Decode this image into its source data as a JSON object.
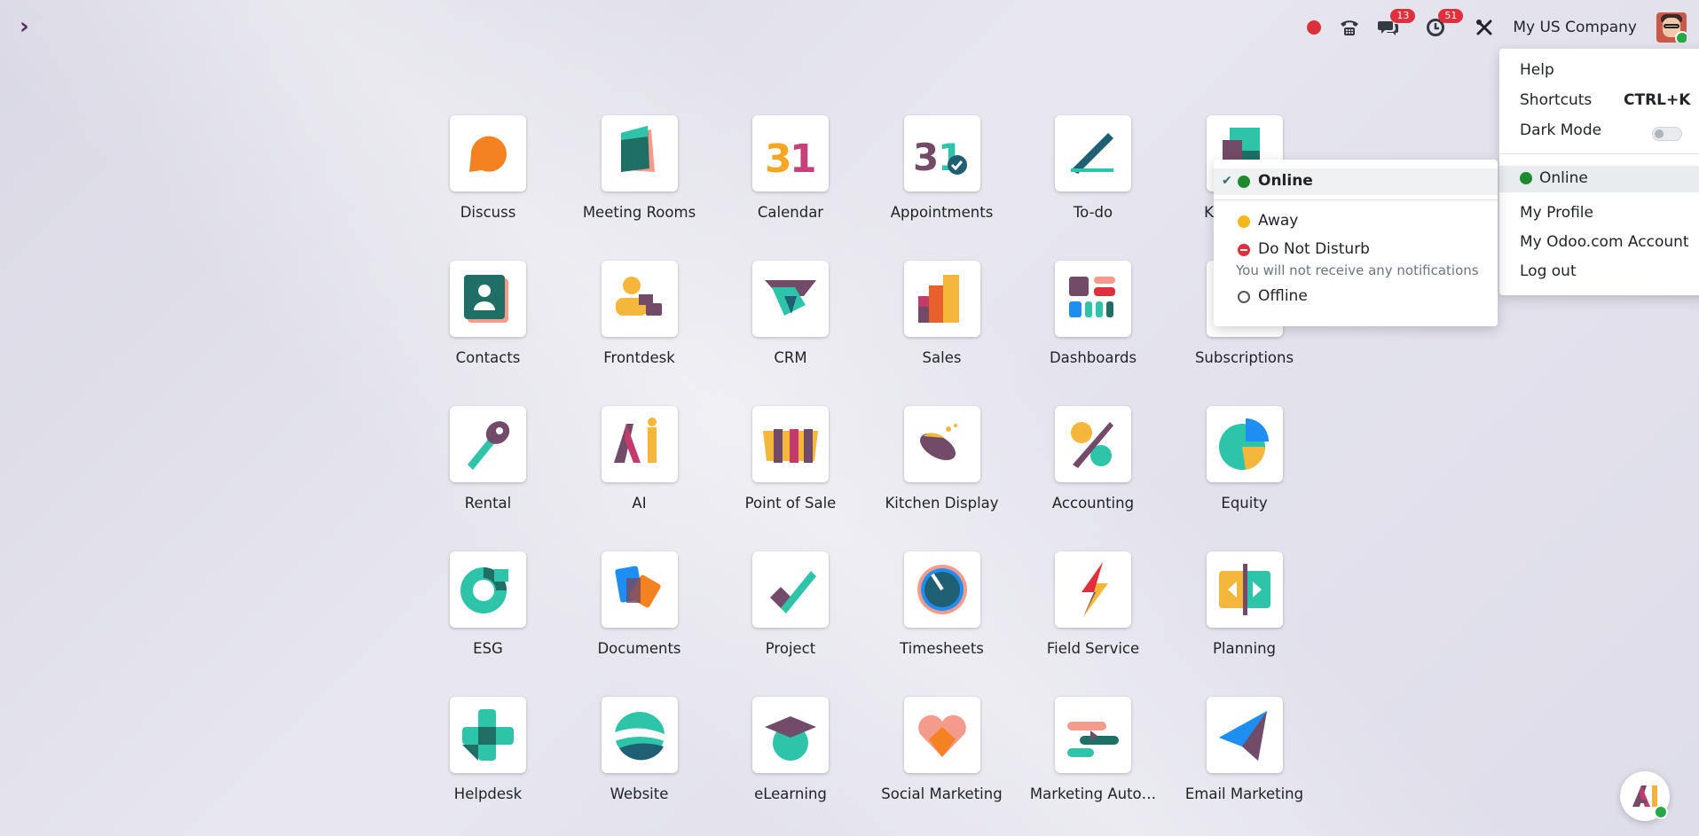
{
  "topbar": {
    "company": "My US Company",
    "chat_badge": "13",
    "activity_badge": "51",
    "icons": [
      "sidebar-chevron-icon",
      "recording-dot-icon",
      "phone-icon",
      "chat-bubbles-icon",
      "clock-icon",
      "tools-icon",
      "avatar"
    ]
  },
  "apps": [
    {
      "label": "Discuss",
      "icon": "discuss-icon"
    },
    {
      "label": "Meeting Rooms",
      "icon": "meeting-rooms-icon"
    },
    {
      "label": "Calendar",
      "icon": "calendar-icon"
    },
    {
      "label": "Appointments",
      "icon": "appointments-icon"
    },
    {
      "label": "To-do",
      "icon": "todo-icon"
    },
    {
      "label": "Knowledge",
      "icon": "knowledge-icon"
    },
    {
      "label": "Contacts",
      "icon": "contacts-icon"
    },
    {
      "label": "Frontdesk",
      "icon": "frontdesk-icon"
    },
    {
      "label": "CRM",
      "icon": "crm-icon"
    },
    {
      "label": "Sales",
      "icon": "sales-icon"
    },
    {
      "label": "Dashboards",
      "icon": "dashboards-icon"
    },
    {
      "label": "Subscriptions",
      "icon": "subscriptions-icon"
    },
    {
      "label": "Rental",
      "icon": "rental-icon"
    },
    {
      "label": "AI",
      "icon": "ai-icon"
    },
    {
      "label": "Point of Sale",
      "icon": "pos-icon"
    },
    {
      "label": "Kitchen Display",
      "icon": "kitchen-display-icon"
    },
    {
      "label": "Accounting",
      "icon": "accounting-icon"
    },
    {
      "label": "Equity",
      "icon": "equity-icon"
    },
    {
      "label": "ESG",
      "icon": "esg-icon"
    },
    {
      "label": "Documents",
      "icon": "documents-icon"
    },
    {
      "label": "Project",
      "icon": "project-icon"
    },
    {
      "label": "Timesheets",
      "icon": "timesheets-icon"
    },
    {
      "label": "Field Service",
      "icon": "field-service-icon"
    },
    {
      "label": "Planning",
      "icon": "planning-icon"
    },
    {
      "label": "Helpdesk",
      "icon": "helpdesk-icon"
    },
    {
      "label": "Website",
      "icon": "website-icon"
    },
    {
      "label": "eLearning",
      "icon": "elearning-icon"
    },
    {
      "label": "Social Marketing",
      "icon": "social-marketing-icon"
    },
    {
      "label": "Marketing Auto…",
      "icon": "marketing-automation-icon"
    },
    {
      "label": "Email Marketing",
      "icon": "email-marketing-icon"
    }
  ],
  "user_menu": {
    "help": "Help",
    "shortcuts": "Shortcuts",
    "shortcuts_key": "CTRL+K",
    "dark_mode": "Dark Mode",
    "status": "Online",
    "my_profile": "My Profile",
    "odoo_account": "My Odoo.com Account",
    "logout": "Log out"
  },
  "status_menu": {
    "online": "Online",
    "away": "Away",
    "dnd": "Do Not Disturb",
    "dnd_desc": "You will not receive any notifications",
    "offline": "Offline",
    "selected": "online"
  },
  "colors": {
    "online": "#1e8a2e",
    "away": "#f2b81c",
    "dnd": "#e0303d",
    "badge": "#e0303d",
    "brand": "#714b67"
  }
}
